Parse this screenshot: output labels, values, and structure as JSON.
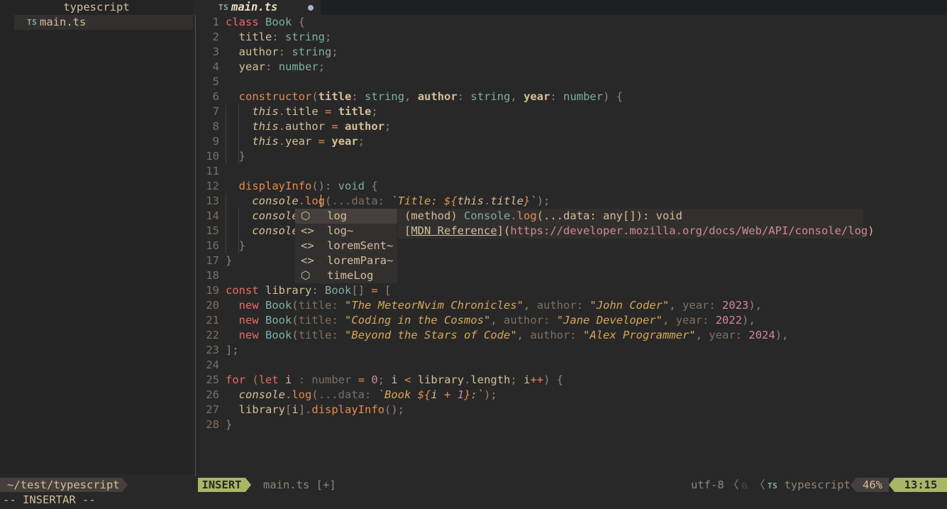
{
  "sidebar": {
    "title": "typescript",
    "file_icon": "TS",
    "file_name": "main.ts"
  },
  "tab": {
    "icon": "TS",
    "name": "main.ts",
    "modified": true
  },
  "editor": {
    "lines": [
      {
        "n": "1",
        "t": "class Book {"
      },
      {
        "n": "2",
        "t": "  title: string;"
      },
      {
        "n": "3",
        "t": "  author: string;"
      },
      {
        "n": "4",
        "t": "  year: number;"
      },
      {
        "n": "5",
        "t": ""
      },
      {
        "n": "6",
        "t": "  constructor(title: string, author: string, year: number) {"
      },
      {
        "n": "7",
        "t": "    this.title = title;"
      },
      {
        "n": "8",
        "t": "    this.author = author;"
      },
      {
        "n": "9",
        "t": "    this.year = year;"
      },
      {
        "n": "10",
        "t": "  }"
      },
      {
        "n": "11",
        "t": ""
      },
      {
        "n": "12",
        "t": "  displayInfo(): void {"
      },
      {
        "n": "13",
        "t": "    console.log(...data: `Title: ${this.title}`);"
      },
      {
        "n": "14",
        "t": "    console"
      },
      {
        "n": "15",
        "t": "    console"
      },
      {
        "n": "16",
        "t": "  }"
      },
      {
        "n": "17",
        "t": "}"
      },
      {
        "n": "18",
        "t": ""
      },
      {
        "n": "19",
        "t": "const library: Book[] = ["
      },
      {
        "n": "20",
        "t": "  new Book(title: \"The MeteorNvim Chronicles\", author: \"John Coder\", year: 2023),"
      },
      {
        "n": "21",
        "t": "  new Book(title: \"Coding in the Cosmos\", author: \"Jane Developer\", year: 2022),"
      },
      {
        "n": "22",
        "t": "  new Book(title: \"Beyond the Stars of Code\", author: \"Alex Programmer\", year: 2024),"
      },
      {
        "n": "23",
        "t": "];"
      },
      {
        "n": "24",
        "t": ""
      },
      {
        "n": "25",
        "t": "for (let i : number = 0; i < library.length; i++) {"
      },
      {
        "n": "26",
        "t": "  console.log(...data: `Book ${i + 1}:`);"
      },
      {
        "n": "27",
        "t": "  library[i].displayInfo();"
      },
      {
        "n": "28",
        "t": "}"
      }
    ]
  },
  "completion": {
    "items": [
      {
        "icon": "cube-icon",
        "glyph": "⬡",
        "label": "log",
        "selected": true
      },
      {
        "icon": "snippet-icon",
        "glyph": "<>",
        "label": "log~",
        "selected": false
      },
      {
        "icon": "snippet-icon",
        "glyph": "<>",
        "label": "loremSent~",
        "selected": false
      },
      {
        "icon": "snippet-icon",
        "glyph": "<>",
        "label": "loremPara~",
        "selected": false
      },
      {
        "icon": "cube-icon",
        "glyph": "⬡",
        "label": "timeLog",
        "selected": false
      }
    ],
    "doc": {
      "signature": "(method) Console.log(...data: any[]): void",
      "reference": "[MDN Reference](https://developer.mozilla.org/docs/Web/API/console/log)"
    }
  },
  "statusline": {
    "cwd": "~/test/typescript",
    "mode": "INSERT",
    "file": "main.ts [+]",
    "encoding": "utf-8",
    "os_icon": "linux-icon",
    "filetype_icon": "TS",
    "filetype": "typescript",
    "percent": "46%",
    "position": "13:15"
  },
  "cmdline": "-- INSERTAR --",
  "colors": {
    "background": "#282828",
    "accent": "#a9b665",
    "keyword": "#ea6962",
    "type": "#7daea3",
    "string": "#d8a657",
    "number": "#d3869b"
  }
}
